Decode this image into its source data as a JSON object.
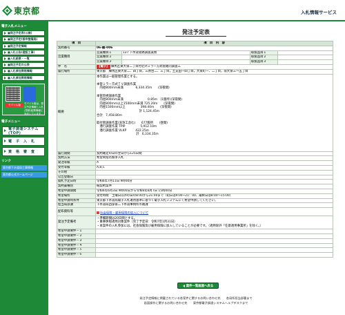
{
  "header": {
    "logo_text": "東京都",
    "title": "入札情報サービス"
  },
  "sidebar": {
    "section1": "電子入札メニュー",
    "menu": [
      "■発注予定表(公開)",
      "■発注予定(都市整備局)",
      "■発注予定情報",
      "■入札公告(建設工事)",
      "■入札結果・一覧",
      "■発注予定の公表",
      "■入札参加資格情報",
      "■入札参加資格情報"
    ],
    "mobile_label": "モバイル版",
    "mobile_text": "モバイル版は、発注予定情報と入札(見積)結果情報に対応しています。",
    "section2": "電子メニュー",
    "big_buttons": [
      "電子調達システム(TOP)",
      "電　子　入　札",
      "資　格　審　査"
    ],
    "section3": "リンク",
    "links": [
      "東京都下水道局工事情報",
      "東京都公式ホームページ"
    ]
  },
  "main": {
    "title": "発注予定表",
    "col_item": "項　目",
    "col_content": "項　目　内　容",
    "contract_no_label": "契約番号",
    "contract_no": "06-難-006",
    "biz_type_label": "営業種目",
    "biz_rows": [
      {
        "label": "営業種目１",
        "value": "127 下水道管路調査業務",
        "rank_label": "取扱品目１",
        "rank": ""
      },
      {
        "label": "営業種目２",
        "value": "",
        "rank_label": "取扱品目２",
        "rank": ""
      },
      {
        "label": "営業種目３",
        "value": "",
        "rank_label": "取扱品目３",
        "rank": ""
      }
    ],
    "name_label": "件　名",
    "name_badge": "【電子】",
    "name_value": "練馬区東大泉二丁目付近外ミラー方式管路内調査工",
    "place_label": "履行場所",
    "place_value": "東京都　練馬区東大泉二、四丁目，三原台二、三丁目，土支田一四丁目，大泉町一、二丁目，南大泉三～五丁目",
    "summary_label": "概要",
    "summary_text": "本作業は一般管理作業とする。\n\n本管ミラー方式ＴＶ調査作業\n　内径800mm未満　　　　6,334.35m　　(深夜間)\n\n本管目視調査作業\n　内径800mm未満　　　　　　　　0.85m　(1箇所)(深夜間)\n　内径800mm以上1500mm未満 725.20m　　(深夜間)\n　内径1500mm以上　　　　　398.40m　　(深夜間)\n　　　　　　　　　　　　　　計 1,124.45m\n合計　7,458.80m\n\n取付管調査作業(洗浄工含む)　　677箇所　　(昼間)\n　潜行調査作業 TPIP　　　　　5,912.10m\n　潜行調査作業 VLKP　　　422.25m\n　　　　　　　　　　　　　計　6,334.35m",
    "rows": [
      {
        "label": "履行期間",
        "value": "契約確定の日の翌日から125日間"
      },
      {
        "label": "契約方法",
        "value": "希望制指名競争入札"
      },
      {
        "label": "発注等級",
        "value": "A"
      },
      {
        "label": "受付等級",
        "value": "A,B,C"
      },
      {
        "label": "その他",
        "value": ""
      },
      {
        "label": "公告登載日",
        "value": ""
      },
      {
        "label": "開札予定日時",
        "value": "令和6年7月11日 9時00分"
      },
      {
        "label": "契約書種別",
        "value": "紙契約案件"
      },
      {
        "label": "希望申請期間",
        "value": "令和6年6月3日 9時00分から令和6年6月7日 15時00分"
      },
      {
        "label": "希望場所",
        "value": "受付時間　土曜日以外の日の8:00から21:00まで（初日は9:00~21：00、最終日は8:00～15:00）"
      },
      {
        "label": "希望申請時条件",
        "value": "東京都下水道局電子入札運用基準に基づく電子入札システムにて希望申請してください。"
      },
      {
        "label": "担当局部課",
        "value": "下水道局西部第二下水道事務所市路課"
      }
    ],
    "doc_label": "配布資料等",
    "doc_link": "社会保険・雇用保険の加入について",
    "notes_label": "発注予定備考",
    "notes": [
      "・準備期間は20日間とする。",
      "・重事休暇適用対象案件（完了予定日：令和7年1月31日）",
      "・本案件の入札参加には、社会保険及び雇用保険に加入していることが必要です。（適用除外「任意適用事業所」を除く。）"
    ],
    "cond_rows": [
      {
        "label": "希望申請要件－１",
        "value": ""
      },
      {
        "label": "希望申請要件－２",
        "value": ""
      },
      {
        "label": "希望申請要件－３",
        "value": ""
      },
      {
        "label": "希望申請要件－４",
        "value": ""
      },
      {
        "label": "希望申請要件－５",
        "value": ""
      },
      {
        "label": "希望申請要件－６",
        "value": ""
      }
    ],
    "back_button": "案件一覧画面へ戻る"
  },
  "footer": {
    "line1": "発注予定情報に掲載されている各案件に関するお問い合わせ先　　各局所担当部署まで",
    "line2": "画面操作に関するお問い合わせ先　　東京都電子調達システムヘルプデスクまで"
  },
  "colors": {
    "brand_green": "#1e8a38",
    "header_green": "#d4e7d4",
    "label_green": "#e8f3e8"
  }
}
